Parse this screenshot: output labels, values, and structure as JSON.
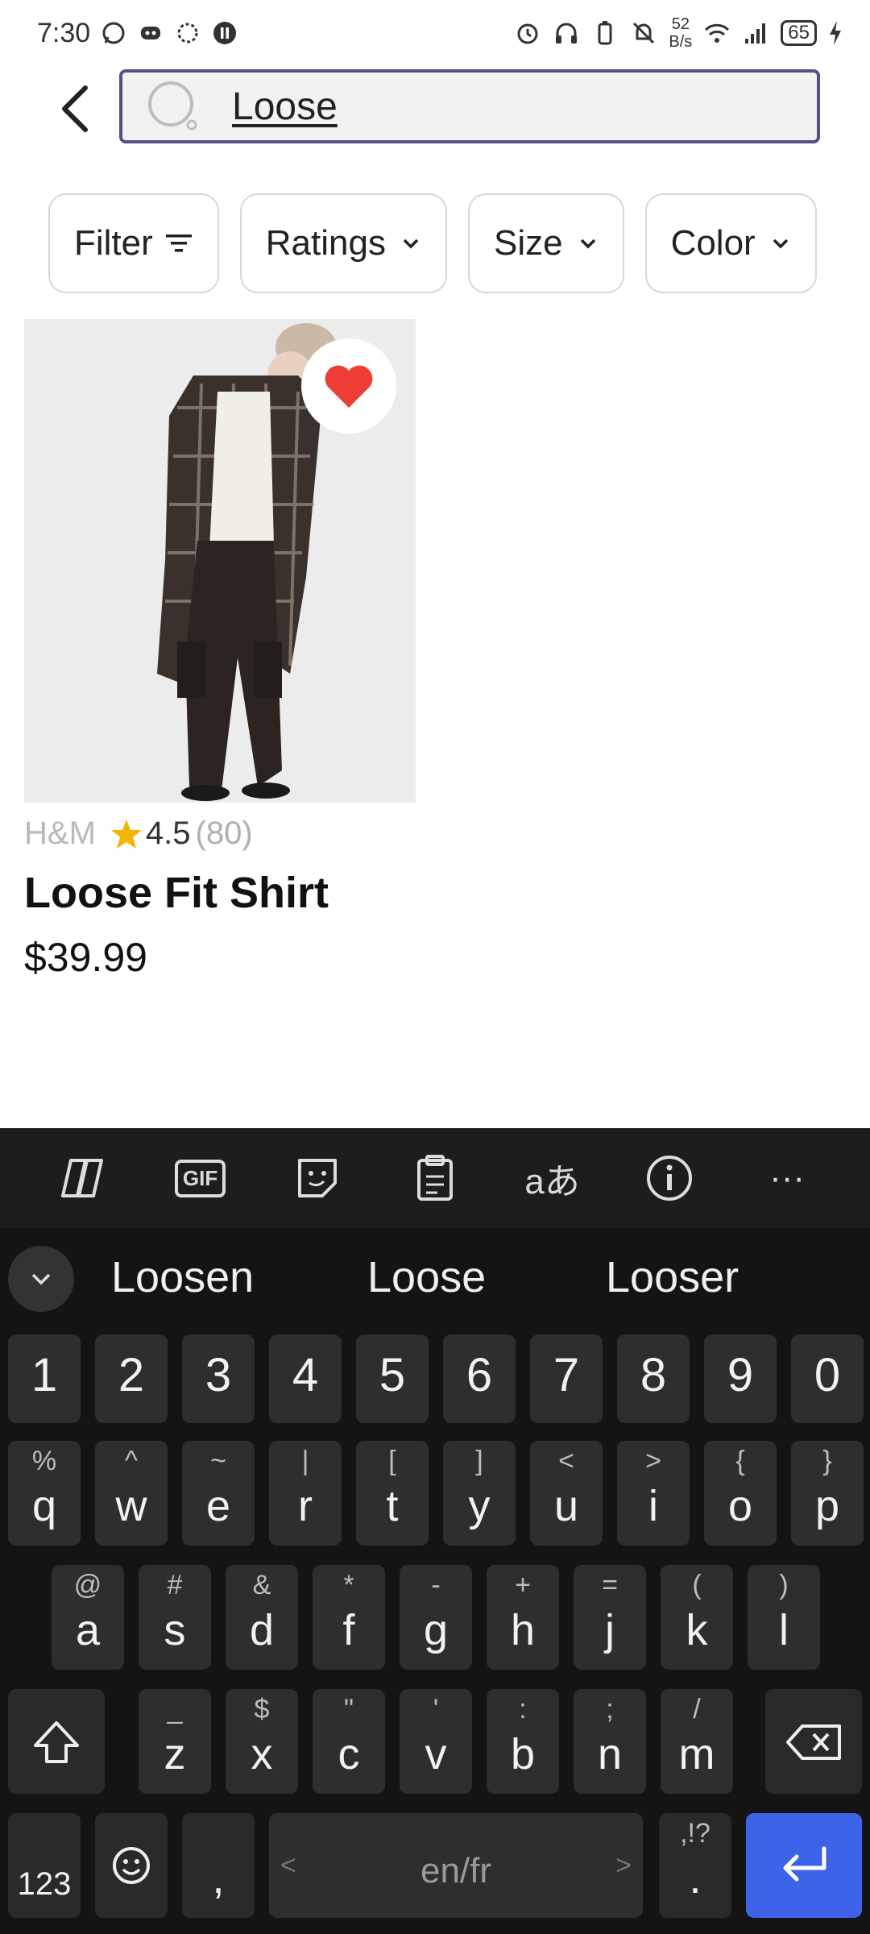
{
  "status_bar": {
    "time": "7:30",
    "net_speed_value": "52",
    "net_speed_unit": "B/s",
    "battery": "65"
  },
  "search": {
    "query": "Loose"
  },
  "filters": [
    {
      "label": "Filter"
    },
    {
      "label": "Ratings"
    },
    {
      "label": "Size"
    },
    {
      "label": "Color"
    }
  ],
  "product": {
    "brand": "H&M",
    "rating": "4.5",
    "review_count": "(80)",
    "title": "Loose Fit Shirt",
    "price": "$39.99",
    "favorited": true
  },
  "keyboard": {
    "toolbar": [
      "copilot-icon",
      "gif-icon",
      "sticker-icon",
      "clipboard-icon",
      "translate-icon",
      "info-icon",
      "more-icon"
    ],
    "gif_label": "GIF",
    "translate_label": "aあ",
    "more_label": "···",
    "suggestions": [
      "Loosen",
      "Loose",
      "Looser"
    ],
    "numbers": [
      "1",
      "2",
      "3",
      "4",
      "5",
      "6",
      "7",
      "8",
      "9",
      "0"
    ],
    "row1": [
      [
        "q",
        "%"
      ],
      [
        "w",
        "^"
      ],
      [
        "e",
        "~"
      ],
      [
        "r",
        "|"
      ],
      [
        "t",
        "["
      ],
      [
        "y",
        "]"
      ],
      [
        "u",
        "<"
      ],
      [
        "i",
        ">"
      ],
      [
        "o",
        "{"
      ],
      [
        "p",
        "}"
      ]
    ],
    "row2": [
      [
        "a",
        "@"
      ],
      [
        "s",
        "#"
      ],
      [
        "d",
        "&"
      ],
      [
        "f",
        "*"
      ],
      [
        "g",
        "-"
      ],
      [
        "h",
        "+"
      ],
      [
        "j",
        "="
      ],
      [
        "k",
        "("
      ],
      [
        "l",
        ")"
      ]
    ],
    "row3": [
      [
        "z",
        "_"
      ],
      [
        "x",
        "$"
      ],
      [
        "c",
        "\""
      ],
      [
        "v",
        "'"
      ],
      [
        "b",
        ":"
      ],
      [
        "n",
        ";"
      ],
      [
        "m",
        "/"
      ]
    ],
    "sym_label": "123",
    "comma": ",",
    "space_label": "en/fr",
    "period": ".",
    "period_alt": ",!?"
  }
}
